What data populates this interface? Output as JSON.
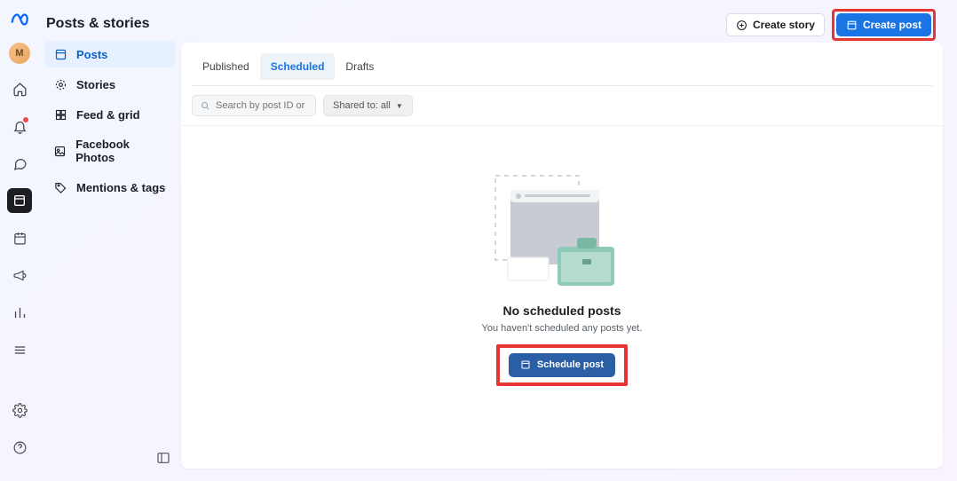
{
  "avatar_initial": "M",
  "page_title": "Posts & stories",
  "header_buttons": {
    "create_story": "Create story",
    "create_post": "Create post"
  },
  "sidebar": {
    "items": [
      {
        "label": "Posts"
      },
      {
        "label": "Stories"
      },
      {
        "label": "Feed & grid"
      },
      {
        "label": "Facebook Photos"
      },
      {
        "label": "Mentions & tags"
      }
    ]
  },
  "tabs": {
    "published": "Published",
    "scheduled": "Scheduled",
    "drafts": "Drafts"
  },
  "filters": {
    "search_placeholder": "Search by post ID or caption",
    "shared_to": "Shared to: all"
  },
  "empty": {
    "title": "No scheduled posts",
    "subtitle": "You haven't scheduled any posts yet.",
    "button": "Schedule post"
  }
}
